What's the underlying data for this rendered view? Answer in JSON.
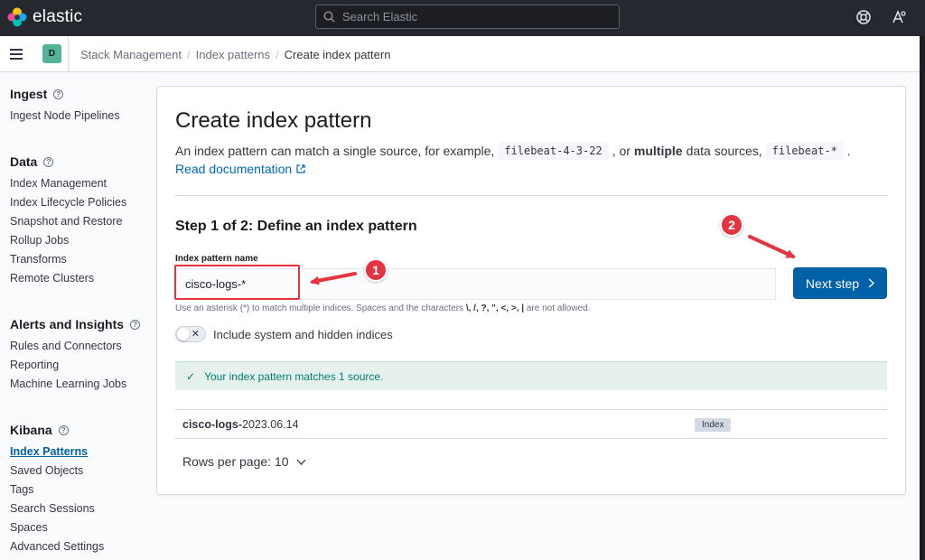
{
  "app": {
    "name": "elastic"
  },
  "search": {
    "placeholder": "Search Elastic"
  },
  "header_icons": [
    "help-lifebuoy-icon",
    "feedback-icon"
  ],
  "space": {
    "initial": "D",
    "color": "#54b399"
  },
  "breadcrumbs": [
    "Stack Management",
    "Index patterns",
    "Create index pattern"
  ],
  "breadcrumb_separator": "/",
  "sidebar": {
    "groups": [
      {
        "title": "Ingest",
        "items": [
          "Ingest Node Pipelines"
        ]
      },
      {
        "title": "Data",
        "items": [
          "Index Management",
          "Index Lifecycle Policies",
          "Snapshot and Restore",
          "Rollup Jobs",
          "Transforms",
          "Remote Clusters"
        ]
      },
      {
        "title": "Alerts and Insights",
        "items": [
          "Rules and Connectors",
          "Reporting",
          "Machine Learning Jobs"
        ]
      },
      {
        "title": "Kibana",
        "items": [
          "Index Patterns",
          "Saved Objects",
          "Tags",
          "Search Sessions",
          "Spaces",
          "Advanced Settings"
        ]
      }
    ],
    "active_item": "Index Patterns"
  },
  "main": {
    "title": "Create index pattern",
    "description": {
      "part1": "An index pattern can match a single source, for example,",
      "example1": "filebeat-4-3-22",
      "part2": ", or",
      "bold": "multiple",
      "part3": "data sources,",
      "example2": "filebeat-*",
      "part4": "."
    },
    "doc_link": "Read documentation",
    "step_title": "Step 1 of 2: Define an index pattern",
    "field_label": "Index pattern name",
    "input_value": "cisco-logs-*",
    "next_button": "Next step",
    "help_text": {
      "prefix": "Use an asterisk (*) to match multiple indices. Spaces and the characters",
      "chars": "\\, /, ?, \", <, >, |",
      "suffix": "are not allowed."
    },
    "toggle_label": "Include system and hidden indices",
    "toggle_on": false,
    "callout": "Your index pattern matches 1 source.",
    "results": [
      {
        "name_bold": "cisco-logs-",
        "name_rest": "2023.06.14",
        "type": "Index"
      }
    ],
    "rows_per_page": "Rows per page: 10"
  },
  "annotations": [
    {
      "number": "1"
    },
    {
      "number": "2"
    }
  ],
  "colors": {
    "header_bg": "#25282f",
    "primary": "#0061a6",
    "link": "#006bb8",
    "success": "#017d73",
    "annotation_red": "#e3343f"
  }
}
